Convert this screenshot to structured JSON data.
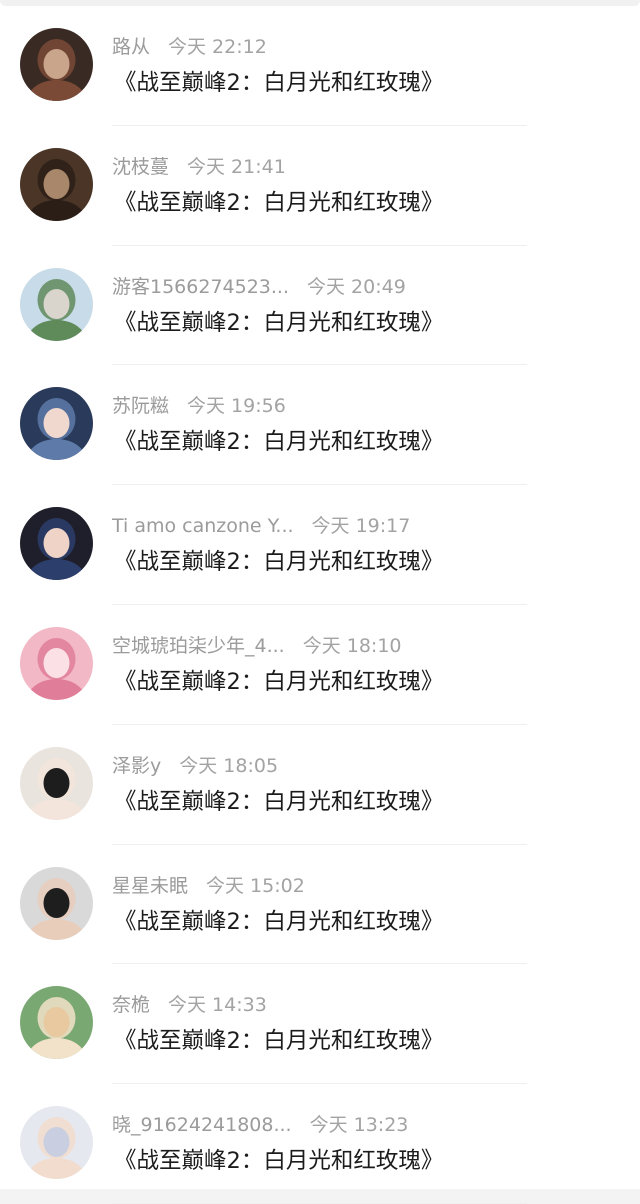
{
  "messages": [
    {
      "name": "路从",
      "time": "今天 22:12",
      "text": "《战至巅峰2：白月光和红玫瑰》",
      "avatar_colors": [
        "#3a2a24",
        "#c9a58c",
        "#7a4a36"
      ],
      "avatar_icon": "woman-portrait-avatar"
    },
    {
      "name": "沈枝蔓",
      "time": "今天 21:41",
      "text": "《战至巅峰2：白月光和红玫瑰》",
      "avatar_colors": [
        "#4a3526",
        "#a8876a",
        "#2b1e17"
      ],
      "avatar_icon": "couple-portrait-avatar"
    },
    {
      "name": "游客1566274523...",
      "time": "今天 20:49",
      "text": "《战至巅峰2：白月光和红玫瑰》",
      "avatar_colors": [
        "#c8dbe8",
        "#d9d5cc",
        "#5f8a5a"
      ],
      "avatar_icon": "landscape-watermelon-avatar"
    },
    {
      "name": "苏阮糍",
      "time": "今天 19:56",
      "text": "《战至巅峰2：白月光和红玫瑰》",
      "avatar_colors": [
        "#2a3a5a",
        "#f1d8cf",
        "#5d7aa8"
      ],
      "avatar_icon": "girl-with-bow-avatar"
    },
    {
      "name": "Ti amo canzone Y...",
      "time": "今天 19:17",
      "text": "《战至巅峰2：白月光和红玫瑰》",
      "avatar_colors": [
        "#1f1f2b",
        "#efd3c7",
        "#2c3e6b"
      ],
      "avatar_icon": "two-girls-avatar"
    },
    {
      "name": "空城琥珀柒少年_4...",
      "time": "今天 18:10",
      "text": "《战至巅峰2：白月光和红玫瑰》",
      "avatar_colors": [
        "#f2b8c6",
        "#fbe1e6",
        "#e07d98"
      ],
      "avatar_icon": "pink-anime-girl-avatar"
    },
    {
      "name": "泽影y",
      "time": "今天 18:05",
      "text": "《战至巅峰2：白月光和红玫瑰》",
      "avatar_colors": [
        "#e9e4dd",
        "#1d1d1d",
        "#f3e5dc"
      ],
      "avatar_icon": "dark-hair-girl-avatar"
    },
    {
      "name": "星星未眠",
      "time": "今天 15:02",
      "text": "《战至巅峰2：白月光和红玫瑰》",
      "avatar_colors": [
        "#d9d9d9",
        "#1e1e1e",
        "#e8cdbb"
      ],
      "avatar_icon": "man-in-suit-avatar"
    },
    {
      "name": "奈桅",
      "time": "今天 14:33",
      "text": "《战至巅峰2：白月光和红玫瑰》",
      "avatar_colors": [
        "#7aa872",
        "#e8c9a0",
        "#f2e2c9"
      ],
      "avatar_icon": "girl-in-garden-avatar"
    },
    {
      "name": "晓_91624241808...",
      "time": "今天 13:23",
      "text": "《战至巅峰2：白月光和红玫瑰》",
      "avatar_colors": [
        "#e6e8ef",
        "#c9cfe0",
        "#f1dccd"
      ],
      "avatar_icon": "anime-girl-white-avatar"
    }
  ]
}
